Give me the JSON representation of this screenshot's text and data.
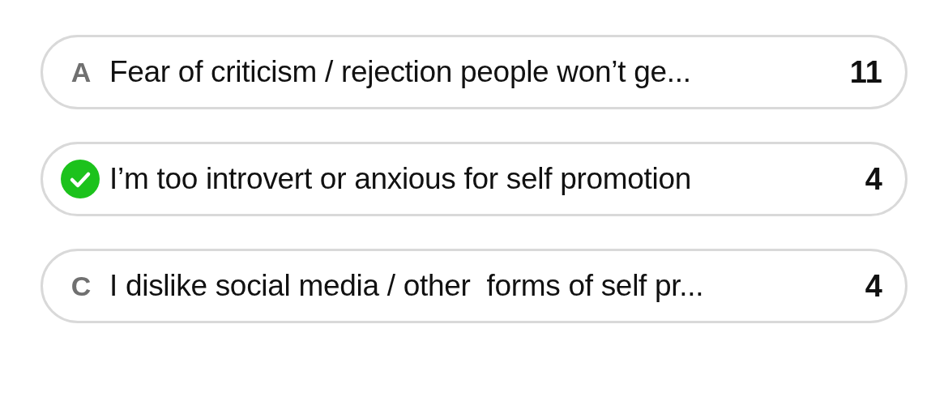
{
  "options": [
    {
      "letter": "A",
      "text": "Fear of criticism / rejection people won’t ge...",
      "count": "11",
      "selected": false
    },
    {
      "text": "I’m too introvert or anxious for self promotion",
      "count": "4",
      "selected": true
    },
    {
      "letter": "C",
      "text": "I dislike social media / other  forms of self pr...",
      "count": "4",
      "selected": false
    }
  ]
}
